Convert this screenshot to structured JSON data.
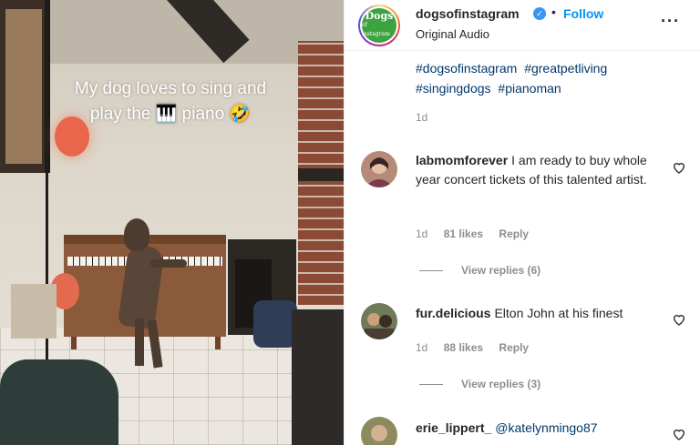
{
  "video": {
    "overlay_line1": "My dog loves to sing and",
    "overlay_line2": "play the 🎹 piano 🤣"
  },
  "header": {
    "username": "dogsofinstagram",
    "dot": "•",
    "follow_label": "Follow",
    "subtitle": "Original Audio",
    "logo_text": "Dogs",
    "logo_small": "of instagram"
  },
  "caption": {
    "hashtags": [
      "#dogsofinstagram",
      "#greatpetliving",
      "#singingdogs",
      "#pianoman"
    ],
    "time": "1d"
  },
  "comments": [
    {
      "username": "labmomforever",
      "text": "I am ready to buy whole year concert tickets of this talented artist.",
      "time": "1d",
      "likes": "81 likes",
      "reply": "Reply",
      "view_replies": "View replies (6)"
    },
    {
      "username": "fur.delicious",
      "text": "Elton John at his finest",
      "time": "1d",
      "likes": "88 likes",
      "reply": "Reply",
      "view_replies": "View replies (3)"
    },
    {
      "username": "erie_lippert_",
      "text": "@katelynmingo87"
    }
  ],
  "colors": {
    "accent": "#0095f6",
    "hashtag": "#00376b",
    "muted": "#8e8e8e"
  }
}
